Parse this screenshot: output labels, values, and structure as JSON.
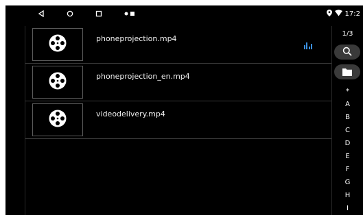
{
  "status_bar": {
    "nav_icons": [
      "back-icon",
      "home-icon",
      "recents-icon",
      "notification-dots-icon"
    ],
    "time": "17:2",
    "status_icons": [
      "location-icon",
      "wifi-icon"
    ]
  },
  "files": [
    {
      "name": "phoneprojection.mp4",
      "playing": true,
      "icon": "film-reel-icon"
    },
    {
      "name": "phoneprojection_en.mp4",
      "playing": false,
      "icon": "film-reel-icon"
    },
    {
      "name": "videodelivery.mp4",
      "playing": false,
      "icon": "film-reel-icon"
    }
  ],
  "sidebar": {
    "page_indicator": "1/3",
    "search_icon": "search-icon",
    "folder_icon": "folder-icon",
    "index": [
      "*",
      "A",
      "B",
      "C",
      "D",
      "E",
      "F",
      "G",
      "H",
      "I"
    ]
  },
  "colors": {
    "background": "#000000",
    "accent": "#3a8fe0",
    "pill": "#3a3a3a"
  }
}
